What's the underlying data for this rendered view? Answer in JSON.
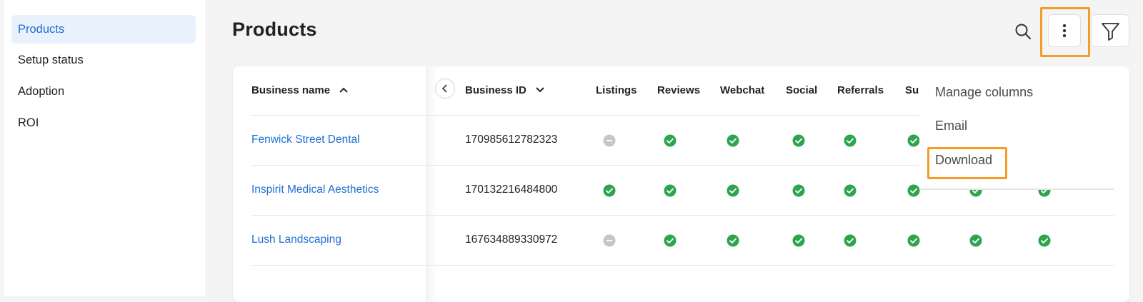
{
  "sidebar": {
    "items": [
      {
        "label": "Products",
        "active": true
      },
      {
        "label": "Setup status"
      },
      {
        "label": "Adoption"
      },
      {
        "label": "ROI"
      }
    ]
  },
  "header": {
    "title": "Products",
    "search_icon": "search-icon",
    "more_icon": "more-vertical-icon",
    "filter_icon": "filter-icon"
  },
  "table": {
    "columns": [
      "Business name",
      "Business ID",
      "Listings",
      "Reviews",
      "Webchat",
      "Social",
      "Referrals",
      "Su"
    ],
    "sort_up_icon": "chevron-up-icon",
    "sort_down_icon": "chevron-down-icon",
    "rows": [
      {
        "name": "Fenwick Street Dental",
        "id": "170985612782323",
        "status": [
          "inactive",
          "active",
          "active",
          "active",
          "active",
          "active"
        ]
      },
      {
        "name": "Inspirit Medical Aesthetics",
        "id": "170132216484800",
        "status": [
          "active",
          "active",
          "active",
          "active",
          "active",
          "active",
          "active",
          "active"
        ]
      },
      {
        "name": "Lush Landscaping",
        "id": "167634889330972",
        "status": [
          "inactive",
          "active",
          "active",
          "active",
          "active",
          "active",
          "active",
          "active"
        ]
      }
    ]
  },
  "menu": {
    "items": [
      "Manage columns",
      "Email",
      "Download"
    ]
  },
  "colors": {
    "accent": "#1f6fd0",
    "active_status": "#2ea44f",
    "inactive_status": "#c6c6c6",
    "highlight": "#f39c27"
  }
}
